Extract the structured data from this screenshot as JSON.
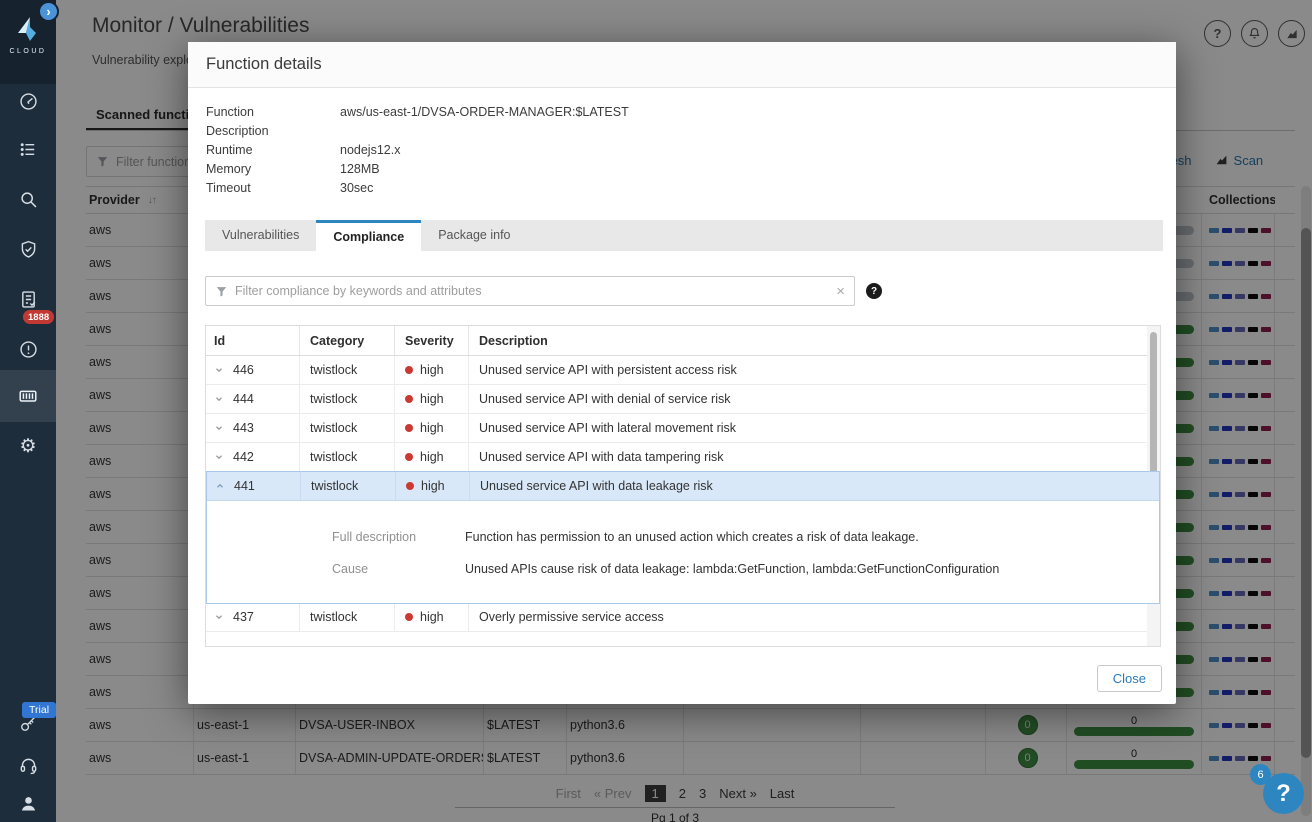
{
  "colors": {
    "accent_blue": "#2e86c1",
    "severity_high": "#cb3a32",
    "bar_green": "#3e8e41",
    "sidebar_bg": "#1e2d3c"
  },
  "icons": {
    "sort_glyph": "↓↑",
    "clear_glyph": "×",
    "help_glyph": "?",
    "gear_glyph": "⚙",
    "expand_glyph": "›",
    "prev_glyph": "«",
    "next_glyph": "»",
    "sidebar": [
      "gauge",
      "checklist",
      "search",
      "shield-check",
      "report-check",
      "alert",
      "container",
      "gear",
      "key",
      "headset",
      "user"
    ]
  },
  "sidebar": {
    "logo_text": "CLOUD",
    "alert_badge": "1888",
    "trial_badge": "Trial"
  },
  "header": {
    "breadcrumb": "Monitor / Vulnerabilities",
    "subnav_tab": "Vulnerability explorer"
  },
  "background_page": {
    "tab": "Scanned functions",
    "filter_placeholder": "Filter functions by",
    "refresh_label": "Refresh",
    "scan_label": "Scan",
    "table": {
      "provider_header": "Provider",
      "collections_header": "Collections",
      "collection_colors": [
        "#4e90c8",
        "#2334bd",
        "#6568b8",
        "#0c0c0c",
        "#8f1f50"
      ],
      "rows": [
        {
          "provider": "aws",
          "bar": "gray"
        },
        {
          "provider": "aws",
          "bar": "gray"
        },
        {
          "provider": "aws",
          "bar": "gray"
        },
        {
          "provider": "aws",
          "bar": "green"
        },
        {
          "provider": "aws",
          "bar": "green"
        },
        {
          "provider": "aws",
          "bar": "green"
        },
        {
          "provider": "aws",
          "bar": "green"
        },
        {
          "provider": "aws",
          "bar": "green"
        },
        {
          "provider": "aws",
          "bar": "green"
        },
        {
          "provider": "aws",
          "bar": "green"
        },
        {
          "provider": "aws",
          "bar": "green"
        },
        {
          "provider": "aws",
          "bar": "green"
        },
        {
          "provider": "aws",
          "bar": "green"
        },
        {
          "provider": "aws",
          "bar": "green"
        },
        {
          "provider": "aws",
          "bar": "green"
        },
        {
          "provider": "aws",
          "region": "us-east-1",
          "name": "DVSA-USER-INBOX",
          "version": "$LATEST",
          "runtime": "python3.6",
          "vuln_badge": "0",
          "compliance_value": "0",
          "bar": "green"
        },
        {
          "provider": "aws",
          "region": "us-east-1",
          "name": "DVSA-ADMIN-UPDATE-ORDERS",
          "version": "$LATEST",
          "runtime": "python3.6",
          "vuln_badge": "0",
          "compliance_value": "0",
          "bar": "green"
        }
      ]
    },
    "pagination": {
      "first": "First",
      "prev": "Prev",
      "pages": [
        "1",
        "2",
        "3"
      ],
      "current_page": "1",
      "next": "Next",
      "last": "Last",
      "status": "Pg 1 of 3"
    }
  },
  "modal": {
    "title": "Function details",
    "details": {
      "function_label": "Function",
      "function_value": "aws/us-east-1/DVSA-ORDER-MANAGER:$LATEST",
      "description_label": "Description",
      "description_value": "",
      "runtime_label": "Runtime",
      "runtime_value": "nodejs12.x",
      "memory_label": "Memory",
      "memory_value": "128MB",
      "timeout_label": "Timeout",
      "timeout_value": "30sec"
    },
    "tabs": [
      "Vulnerabilities",
      "Compliance",
      "Package info"
    ],
    "active_tab": "Compliance",
    "filter_placeholder": "Filter compliance by keywords and attributes",
    "table": {
      "columns": [
        "Id",
        "Category",
        "Severity",
        "Description"
      ],
      "rows": [
        {
          "id": "446",
          "category": "twistlock",
          "severity": "high",
          "description": "Unused service API with persistent access risk"
        },
        {
          "id": "444",
          "category": "twistlock",
          "severity": "high",
          "description": "Unused service API with denial of service risk"
        },
        {
          "id": "443",
          "category": "twistlock",
          "severity": "high",
          "description": "Unused service API with lateral movement risk"
        },
        {
          "id": "442",
          "category": "twistlock",
          "severity": "high",
          "description": "Unused service API with data tampering risk"
        },
        {
          "id": "441",
          "category": "twistlock",
          "severity": "high",
          "description": "Unused service API with data leakage risk"
        },
        {
          "id": "437",
          "category": "twistlock",
          "severity": "high",
          "description": "Overly permissive service access"
        }
      ],
      "expanded": {
        "row_id": "441",
        "full_description_label": "Full description",
        "full_description": "Function has permission to an unused action which creates a risk of data leakage.",
        "cause_label": "Cause",
        "cause": "Unused APIs cause risk of data leakage: lambda:GetFunction, lambda:GetFunctionConfiguration"
      }
    },
    "close_label": "Close"
  },
  "help_fab": {
    "label": "?",
    "badge": "6"
  }
}
